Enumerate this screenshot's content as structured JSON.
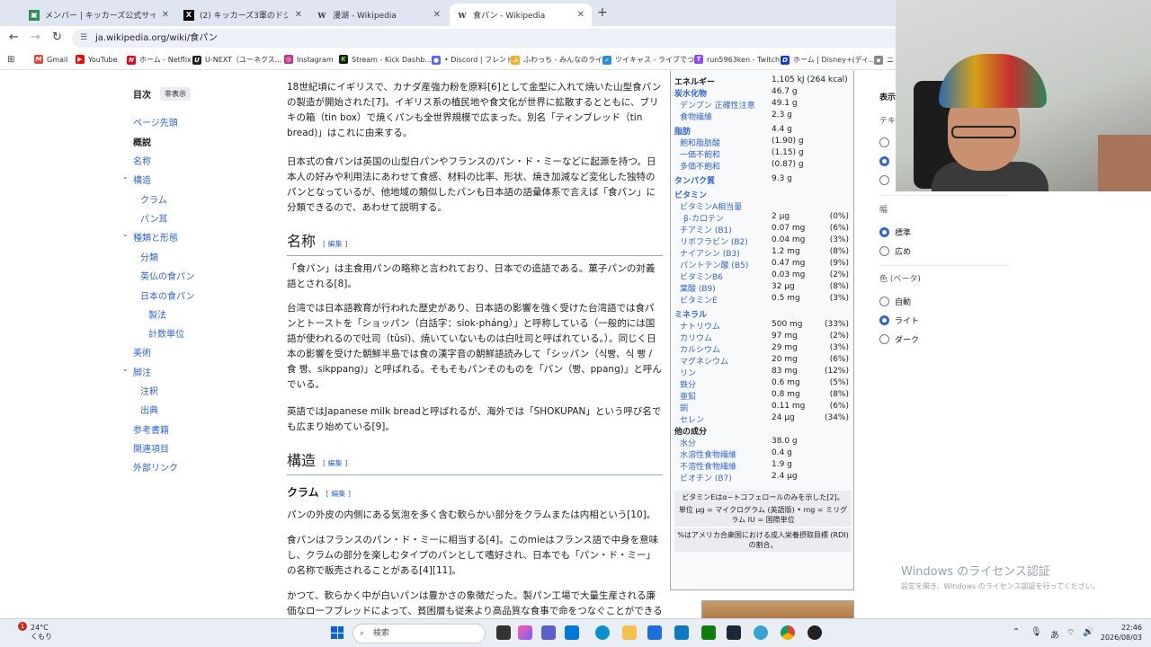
{
  "tabs": [
    {
      "title": "メンバー | キッカーズ公式サイト",
      "icon": "green-square-icon",
      "color": "#2e8b57",
      "active": false
    },
    {
      "title": "(2) キッカーズ3軍のドジョウ（@run",
      "icon": "x-logo-icon",
      "color": "#000000",
      "active": false
    },
    {
      "title": "漫湖 - Wikipedia",
      "icon": "wikipedia-icon",
      "color": "#333333",
      "active": false
    },
    {
      "title": "食パン - Wikipedia",
      "icon": "wikipedia-icon",
      "color": "#333333",
      "active": true
    }
  ],
  "address": {
    "url": "ja.wikipedia.org/wiki/食パン"
  },
  "bookmarks": [
    {
      "label": "Gmail",
      "color": "#ea4335"
    },
    {
      "label": "YouTube",
      "color": "#ff0000"
    },
    {
      "label": "ホーム - Netflix",
      "color": "#e50914"
    },
    {
      "label": "U-NEXT（ユーネクス...",
      "color": "#222222"
    },
    {
      "label": "Instagram",
      "color": "#c13584"
    },
    {
      "label": "Stream - Kick Dashb...",
      "color": "#53fc18"
    },
    {
      "label": "• Discord | フレンド",
      "color": "#5865f2"
    },
    {
      "label": "ふわっち - みんなのライ...",
      "color": "#f6a821"
    },
    {
      "label": "ツイキャス - ライブでつ...",
      "color": "#2b90d9"
    },
    {
      "label": "run5963ken - Twitch",
      "color": "#9146ff"
    },
    {
      "label": "ホーム | Disney+(ディ...",
      "color": "#113ccf"
    },
    {
      "label": "ニ",
      "color": "#888888"
    }
  ],
  "toc": {
    "title": "目次",
    "hide_label": "非表示",
    "items": [
      {
        "label": "ページ先頭",
        "level": 0,
        "current": false,
        "chevron": false
      },
      {
        "label": "概説",
        "level": 0,
        "current": true,
        "chevron": false
      },
      {
        "label": "名称",
        "level": 0,
        "current": false,
        "chevron": false
      },
      {
        "label": "構造",
        "level": 0,
        "current": false,
        "chevron": true
      },
      {
        "label": "クラム",
        "level": 1,
        "current": false,
        "chevron": false
      },
      {
        "label": "パン耳",
        "level": 1,
        "current": false,
        "chevron": false
      },
      {
        "label": "種類と形態",
        "level": 0,
        "current": false,
        "chevron": true
      },
      {
        "label": "分類",
        "level": 1,
        "current": false,
        "chevron": false
      },
      {
        "label": "英仏の食パン",
        "level": 1,
        "current": false,
        "chevron": false
      },
      {
        "label": "日本の食パン",
        "level": 1,
        "current": false,
        "chevron": false
      },
      {
        "label": "製法",
        "level": 2,
        "current": false,
        "chevron": false
      },
      {
        "label": "計数単位",
        "level": 2,
        "current": false,
        "chevron": false
      },
      {
        "label": "美術",
        "level": 0,
        "current": false,
        "chevron": false
      },
      {
        "label": "脚注",
        "level": 0,
        "current": false,
        "chevron": true
      },
      {
        "label": "注釈",
        "level": 1,
        "current": false,
        "chevron": false
      },
      {
        "label": "出典",
        "level": 1,
        "current": false,
        "chevron": false
      },
      {
        "label": "参考書籍",
        "level": 0,
        "current": false,
        "chevron": false
      },
      {
        "label": "関連項目",
        "level": 0,
        "current": false,
        "chevron": false
      },
      {
        "label": "外部リンク",
        "level": 0,
        "current": false,
        "chevron": false
      }
    ]
  },
  "article": {
    "p1": "18世紀頃にイギリスで、カナダ産強力粉を原料[6]として金型に入れて焼いた山型食パンの製造が開始された[7]。イギリス系の植民地や食文化が世界に拡散するとともに、ブリキの箱（tin box）で焼くパンも全世界規模で広まった。別名「ティンブレッド（tin bread)」はこれに由来する。",
    "p2": "日本式の食パンは英国の山型白パンやフランスのパン・ド・ミーなどに起源を持つ。日本人の好みや利用法にあわせて食感、材料の比率、形状、焼き加減など変化した独特のパンとなっているが、他地域の類似したパンも日本語の語彙体系で言えば「食パン」に分類できるので、あわせて説明する。",
    "h_name": "名称",
    "p3": "「食パン」は主食用パンの略称と言われており、日本での造語である。菓子パンの対義語とされる[8]。",
    "p4": "台湾では日本語教育が行われた歴史があり、日本語の影響を強く受けた台湾語では食パンとトーストを「ショッパン（白話字：siok-pháng）」と呼称している（一般的には国語が使われるので吐司（tǔsī)、焼いていないものは白吐司と呼ばれている。）。同じく日本の影響を受けた朝鮮半島では食の漢字音の朝鮮語読みして「シッパン（식빵、식 빵 / 食 빵、sikppang)」と呼ばれる。そもそもパンそのものを「パン（빵、ppang)」と呼んでいる。",
    "p5": "英語ではJapanese milk breadと呼ばれるが、海外では「SHOKUPAN」という呼び名でも広まり始めている[9]。",
    "h_structure": "構造",
    "h_crumb": "クラム",
    "p6": "パンの外皮の内側にある気泡を多く含む軟らかい部分をクラムまたは内相という[10]。",
    "p7": "食パンはフランスのパン・ド・ミーに相当する[4]。このmieはフランス語で中身を意味し、クラムの部分を楽しむタイプのパンとして嗜好され、日本でも「パン・ド・ミー」の名称で販売されることがある[4][11]。",
    "p8": "かつて、軟らかく中が白いパンは豊かさの象徴だった。製パン工場で大量生産される廉価なローフブレッドによって、貧困層も従来より高品質な食事で命をつなぐことができる",
    "edit_label": "[ 編集 ]"
  },
  "infobox": {
    "rows": [
      {
        "name": "エネルギー",
        "value": "1,105 kJ (264 kcal)",
        "pct": "",
        "style": "bold"
      },
      {
        "name": "炭水化物",
        "value": "46.7 g",
        "pct": "",
        "style": "section"
      },
      {
        "name": "デンプン 正確性注意",
        "value": "49.1 g",
        "pct": "",
        "style": "sub"
      },
      {
        "name": "食物繊維",
        "value": "2.3 g",
        "pct": "",
        "style": "sub"
      },
      {
        "name": "脂肪",
        "value": "4.4 g",
        "pct": "",
        "style": "section"
      },
      {
        "name": "飽和脂肪酸",
        "value": "(1.90) g",
        "pct": "",
        "style": "sub"
      },
      {
        "name": "一価不飽和",
        "value": "(1.15) g",
        "pct": "",
        "style": "sub"
      },
      {
        "name": "多価不飽和",
        "value": "(0.87) g",
        "pct": "",
        "style": "sub"
      },
      {
        "name": "タンパク質",
        "value": "9.3 g",
        "pct": "",
        "style": "section"
      },
      {
        "name": "ビタミン",
        "value": "",
        "pct": "",
        "style": "section"
      },
      {
        "name": "ビタミンA相当量",
        "value": "",
        "pct": "",
        "style": "sub"
      },
      {
        "name": "β-カロテン",
        "value": "2 µg",
        "pct": "(0%)",
        "style": "deep"
      },
      {
        "name": "チアミン (B1)",
        "value": "0.07 mg",
        "pct": "(6%)",
        "style": "sub"
      },
      {
        "name": "リボフラビン (B2)",
        "value": "0.04 mg",
        "pct": "(3%)",
        "style": "sub"
      },
      {
        "name": "ナイアシン (B3)",
        "value": "1.2 mg",
        "pct": "(8%)",
        "style": "sub"
      },
      {
        "name": "パントテン酸 (B5)",
        "value": "0.47 mg",
        "pct": "(9%)",
        "style": "sub"
      },
      {
        "name": "ビタミンB6",
        "value": "0.03 mg",
        "pct": "(2%)",
        "style": "sub"
      },
      {
        "name": "葉酸 (B9)",
        "value": "32 µg",
        "pct": "(8%)",
        "style": "sub"
      },
      {
        "name": "ビタミンE",
        "value": "0.5 mg",
        "pct": "(3%)",
        "style": "sub"
      },
      {
        "name": "ミネラル",
        "value": "",
        "pct": "",
        "style": "section"
      },
      {
        "name": "ナトリウム",
        "value": "500 mg",
        "pct": "(33%)",
        "style": "sub"
      },
      {
        "name": "カリウム",
        "value": "97 mg",
        "pct": "(2%)",
        "style": "sub"
      },
      {
        "name": "カルシウム",
        "value": "29 mg",
        "pct": "(3%)",
        "style": "sub"
      },
      {
        "name": "マグネシウム",
        "value": "20 mg",
        "pct": "(6%)",
        "style": "sub"
      },
      {
        "name": "リン",
        "value": "83 mg",
        "pct": "(12%)",
        "style": "sub"
      },
      {
        "name": "鉄分",
        "value": "0.6 mg",
        "pct": "(5%)",
        "style": "sub"
      },
      {
        "name": "亜鉛",
        "value": "0.8 mg",
        "pct": "(8%)",
        "style": "sub"
      },
      {
        "name": "銅",
        "value": "0.11 mg",
        "pct": "(6%)",
        "style": "sub"
      },
      {
        "name": "セレン",
        "value": "24 µg",
        "pct": "(34%)",
        "style": "sub"
      },
      {
        "name": "他の成分",
        "value": "",
        "pct": "",
        "style": "bold"
      },
      {
        "name": "水分",
        "value": "38.0 g",
        "pct": "",
        "style": "sub"
      },
      {
        "name": "水溶性食物繊維",
        "value": "0.4 g",
        "pct": "",
        "style": "sub"
      },
      {
        "name": "不溶性食物繊維",
        "value": "1.9 g",
        "pct": "",
        "style": "sub"
      },
      {
        "name": "ビオチン (B7)",
        "value": "2.4 µg",
        "pct": "",
        "style": "sub"
      }
    ],
    "note1": "ビタミンEはα−トコフェロールのみを示した[2]。",
    "note2": "単位 µg = マイクログラム (英語版) • mg = ミリグラム IU = 国際単位",
    "note3": "%はアメリカ合衆国における成人栄養摂取目標 (RDI) の割合。"
  },
  "appearance": {
    "header": "表示",
    "text_label": "テキ",
    "width_label": "幅",
    "width_options": [
      {
        "label": "標準",
        "selected": true
      },
      {
        "label": "広め",
        "selected": false
      }
    ],
    "color_label": "色 (ベータ)",
    "color_options": [
      {
        "label": "自動",
        "selected": false
      },
      {
        "label": "ライト",
        "selected": true
      },
      {
        "label": "ダーク",
        "selected": false
      }
    ]
  },
  "watermark": {
    "line1": "Windows のライセンス認証",
    "line2": "設定を開き、Windows のライセンス認証を行ってください。"
  },
  "taskbar": {
    "weather_badge": "1",
    "temperature": "24°C",
    "condition": "くもり",
    "search_placeholder": "検索",
    "ime": "あ",
    "time": "22:46",
    "date": "2026/08/03"
  }
}
